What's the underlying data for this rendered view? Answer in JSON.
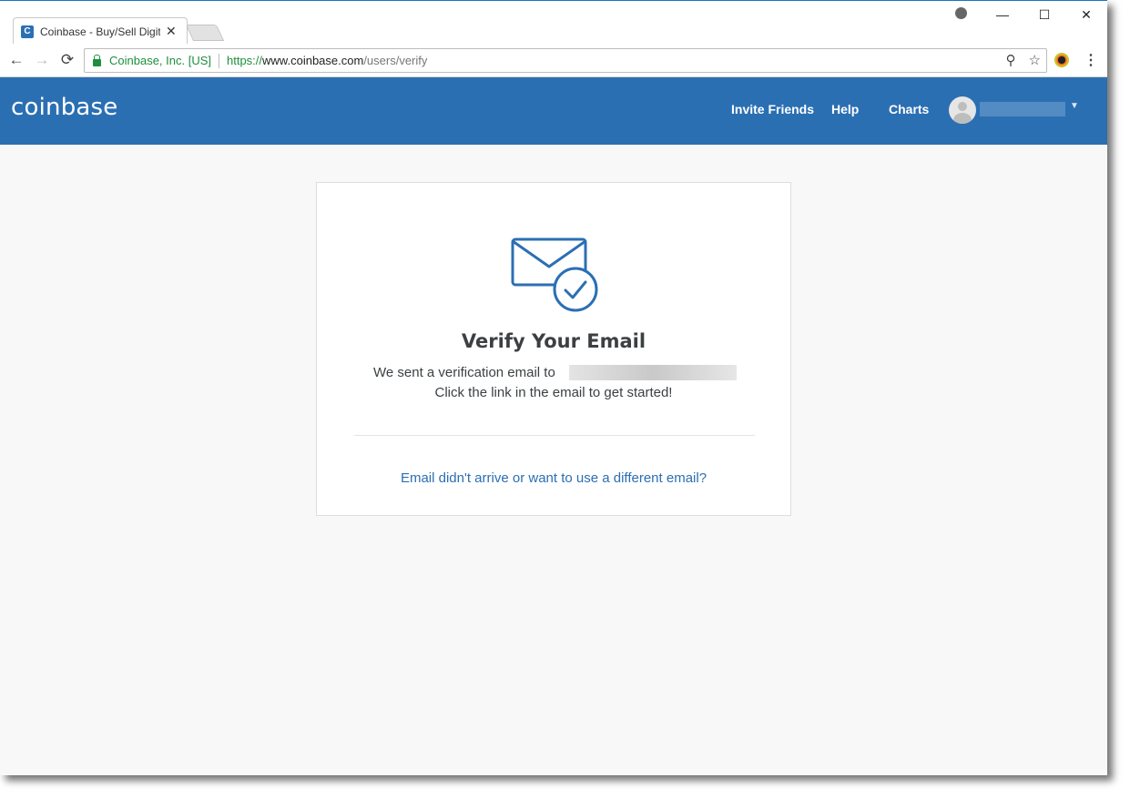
{
  "browser": {
    "tab": {
      "favicon_letter": "C",
      "title": "Coinbase - Buy/Sell Digit",
      "close_glyph": "✕"
    },
    "window_controls": {
      "minimize": "—",
      "maximize": "☐",
      "close": "✕"
    },
    "toolbar": {
      "back": "←",
      "forward": "→",
      "reload": "⟳",
      "menu": "⋮"
    },
    "address_bar": {
      "origin_label": "Coinbase, Inc. [US]",
      "url_scheme": "https://",
      "url_host": "www.coinbase.com",
      "url_path": "/users/verify",
      "key_glyph": "⚲",
      "star_glyph": "☆"
    }
  },
  "site_header": {
    "logo": "coinbase",
    "nav": [
      {
        "label": "Invite Friends"
      },
      {
        "label": "Help"
      },
      {
        "label": "Charts"
      }
    ],
    "user_caret": "▼"
  },
  "verify_card": {
    "icon": "envelope-check-icon",
    "title": "Verify Your Email",
    "message_line1": "We sent a verification email to",
    "message_line2": "Click the link in the email to get started!",
    "resend_link": "Email didn't arrive or want to use a different email?"
  },
  "colors": {
    "brand_blue": "#2b6fb3",
    "page_bg": "#f8f8f8",
    "secure_green": "#1e8e3e"
  }
}
